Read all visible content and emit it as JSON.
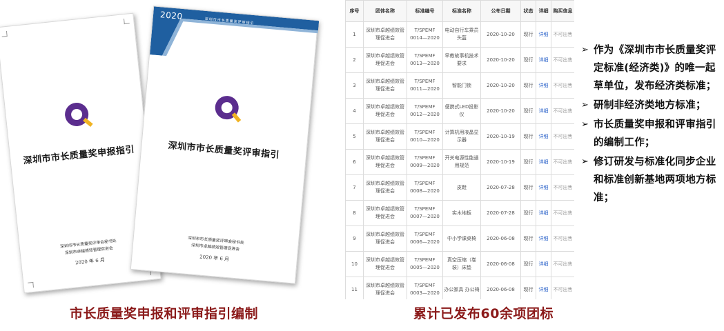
{
  "documents": {
    "back": {
      "title": "深圳市市长质量奖申报指引",
      "footer_lines": [
        "深圳市市长质量奖评审会秘书处",
        "深圳市卓越绩效管理促进会"
      ],
      "date": "2020 年 6 月"
    },
    "front": {
      "banner_year": "2020",
      "banner_text": "深圳市市长质量奖评审指引",
      "title": "深圳市市长质量奖评审指引",
      "footer_lines": [
        "深圳市市长质量奖评审会秘书处",
        "深圳市卓越绩效管理促进会"
      ],
      "date": "2020 年 6 月"
    }
  },
  "table": {
    "headers": [
      "序号",
      "团体名称",
      "标准编号",
      "标准名称",
      "公布日期",
      "状态",
      "详细",
      "购买信息"
    ],
    "rows": [
      {
        "idx": "1",
        "org": "深圳市卓越绩效管理促进会",
        "code": "T/SPEMF 0014—2020",
        "name": "电动自行车乘员头盔",
        "date": "2020-10-20",
        "state": "现行",
        "detail": "详细",
        "buy": "不可出售"
      },
      {
        "idx": "2",
        "org": "深圳市卓越绩效管理促进会",
        "code": "T/SPEMF 0013—2020",
        "name": "早教故事机技术要求",
        "date": "2020-10-20",
        "state": "现行",
        "detail": "详细",
        "buy": "不可出售"
      },
      {
        "idx": "3",
        "org": "深圳市卓越绩效管理促进会",
        "code": "T/SPEMF 0011—2020",
        "name": "智能门锁",
        "date": "2020-10-20",
        "state": "现行",
        "detail": "详细",
        "buy": "不可出售"
      },
      {
        "idx": "4",
        "org": "深圳市卓越绩效管理促进会",
        "code": "T/SPEMF 0012—2020",
        "name": "便携式LED投影仪",
        "date": "2020-10-20",
        "state": "现行",
        "detail": "详细",
        "buy": "不可出售"
      },
      {
        "idx": "5",
        "org": "深圳市卓越绩效管理促进会",
        "code": "T/SPEMF 0010—2020",
        "name": "计算机用液晶显示器",
        "date": "2020-10-19",
        "state": "现行",
        "detail": "详细",
        "buy": "不可出售"
      },
      {
        "idx": "6",
        "org": "深圳市卓越绩效管理促进会",
        "code": "T/SPEMF 0009—2020",
        "name": "开关电源性能通用规范",
        "date": "2020-10-19",
        "state": "现行",
        "detail": "详细",
        "buy": "不可出售"
      },
      {
        "idx": "7",
        "org": "深圳市卓越绩效管理促进会",
        "code": "T/SPEMF 0008—2020",
        "name": "皮鞋",
        "date": "2020-07-28",
        "state": "现行",
        "detail": "详细",
        "buy": "不可出售"
      },
      {
        "idx": "8",
        "org": "深圳市卓越绩效管理促进会",
        "code": "T/SPEMF 0007—2020",
        "name": "实木地板",
        "date": "2020-07-28",
        "state": "现行",
        "detail": "详细",
        "buy": "不可出售"
      },
      {
        "idx": "9",
        "org": "深圳市卓越绩效管理促进会",
        "code": "T/SPEMF 0006—2020",
        "name": "中小学课桌椅",
        "date": "2020-06-08",
        "state": "现行",
        "detail": "详细",
        "buy": "不可出售"
      },
      {
        "idx": "10",
        "org": "深圳市卓越绩效管理促进会",
        "code": "T/SPEMF 0005—2020",
        "name": "真空压缩（卷装）床垫",
        "date": "2020-06-08",
        "state": "现行",
        "detail": "详细",
        "buy": "不可出售"
      },
      {
        "idx": "11",
        "org": "深圳市卓越绩效管理促进会",
        "code": "T/SPEMF 0003—2020",
        "name": "办公家具 办公椅",
        "date": "2020-06-08",
        "state": "现行",
        "detail": "详细",
        "buy": "不可出售"
      }
    ]
  },
  "bullets": [
    "作为《深圳市市长质量奖评定标准(经济类)》的唯一起草单位，发布经济类标准；",
    "研制非经济类地方标准；",
    "市长质量奖申报和评审指引的编制工作；",
    "修订研发与标准化同步企业和标准创新基地两项地方标准；"
  ],
  "captions": {
    "left": "市长质量奖申报和评审指引编制",
    "right": "累计已发布60余项团标"
  },
  "colors": {
    "caption": "#8b1a1a",
    "logo_purple": "#5b2d8e",
    "logo_gold": "#f0b323",
    "banner_blue": "#1f5fa0",
    "link_blue": "#2a62c9"
  },
  "icons": {
    "bullet": "triangle-arrow-icon",
    "logo": "quality-award-logo-icon"
  }
}
